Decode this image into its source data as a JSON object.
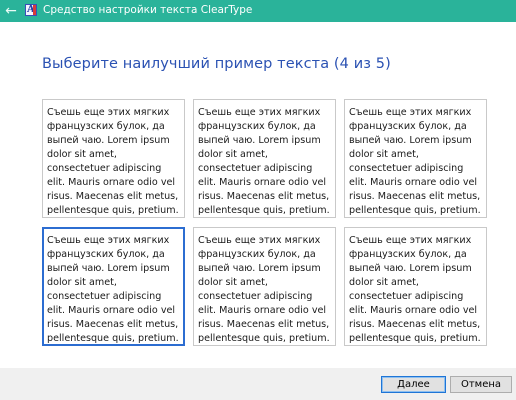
{
  "window": {
    "title": "Средство настройки текста ClearType",
    "back_glyph": "←"
  },
  "heading": "Выберите наилучший пример текста (4 из 5)",
  "samples": [
    {
      "text": "Съешь еще этих мягких французских булок, да выпей чаю. Lorem ipsum dolor sit amet, consectetuer adipiscing elit. Mauris ornare odio vel risus. Maecenas elit metus, pellentesque quis, pretium.",
      "selected": false
    },
    {
      "text": "Съешь еще этих мягких французских булок, да выпей чаю. Lorem ipsum dolor sit amet, consectetuer adipiscing elit. Mauris ornare odio vel risus. Maecenas elit metus, pellentesque quis, pretium.",
      "selected": false
    },
    {
      "text": "Съешь еще этих мягких французских булок, да выпей чаю. Lorem ipsum dolor sit amet, consectetuer adipiscing elit. Mauris ornare odio vel risus. Maecenas elit metus, pellentesque quis, pretium.",
      "selected": false
    },
    {
      "text": "Съешь еще этих мягких французских булок, да выпей чаю. Lorem ipsum dolor sit amet, consectetuer adipiscing elit. Mauris ornare odio vel risus. Maecenas elit metus, pellentesque quis, pretium.",
      "selected": true
    },
    {
      "text": "Съешь еще этих мягких французских булок, да выпей чаю. Lorem ipsum dolor sit amet, consectetuer adipiscing elit. Mauris ornare odio vel risus. Maecenas elit metus, pellentesque quis, pretium.",
      "selected": false
    },
    {
      "text": "Съешь еще этих мягких французских булок, да выпей чаю. Lorem ipsum dolor sit amet, consectetuer adipiscing elit. Mauris ornare odio vel risus. Maecenas elit metus, pellentesque quis, pretium.",
      "selected": false
    }
  ],
  "buttons": {
    "next": "Далее",
    "cancel": "Отмена"
  },
  "colors": {
    "titlebar": "#2ab39a",
    "heading": "#2b52b3",
    "selection": "#2c6dd1"
  }
}
